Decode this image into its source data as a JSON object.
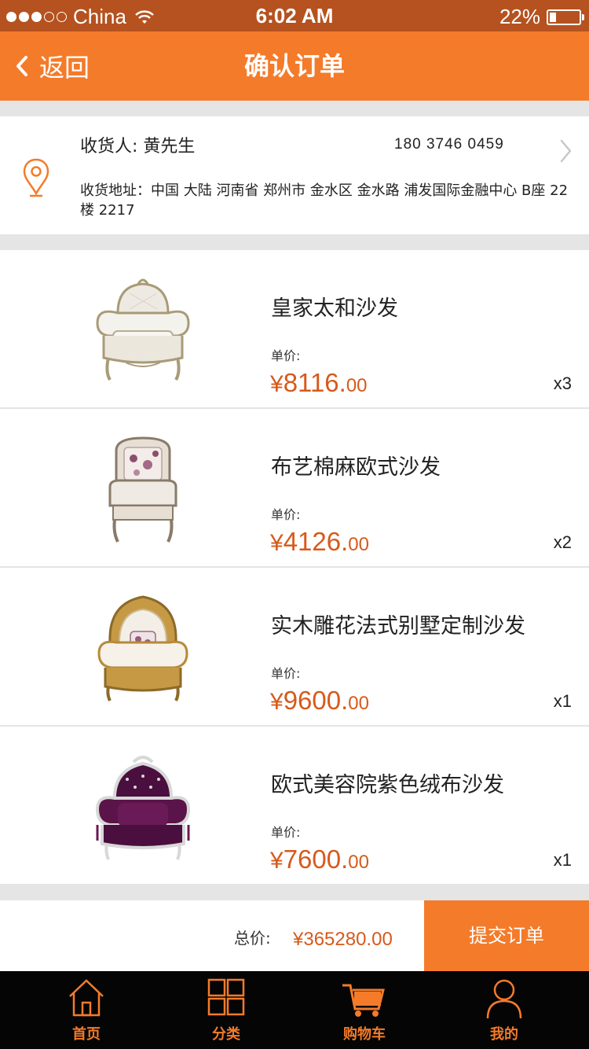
{
  "status_bar": {
    "carrier": "China",
    "time": "6:02 AM",
    "battery_text": "22%",
    "battery_level": 0.22
  },
  "nav": {
    "back_label": "返回",
    "title": "确认订单"
  },
  "address": {
    "consignee": "收货人: 黄先生",
    "phone": "180 3746 0459",
    "address_text": "收货地址：中国 大陆 河南省 郑州市 金水区 金水路 浦发国际金融中心 B座 22楼 2217"
  },
  "items": [
    {
      "name": "皇家太和沙发",
      "price_label": "单价:",
      "currency": "¥",
      "price_int": "8116.",
      "price_dec": "00",
      "qty": "x3",
      "image_icon": "ornate-white-armchair"
    },
    {
      "name": "布艺棉麻欧式沙发",
      "price_label": "单价:",
      "currency": "¥",
      "price_int": "4126.",
      "price_dec": "00",
      "qty": "x2",
      "image_icon": "floral-fabric-chair"
    },
    {
      "name": "实木雕花法式别墅定制沙发",
      "price_label": "单价:",
      "currency": "¥",
      "price_int": "9600.",
      "price_dec": "00",
      "qty": "x1",
      "image_icon": "gold-carved-armchair"
    },
    {
      "name": "欧式美容院紫色绒布沙发",
      "price_label": "单价:",
      "currency": "¥",
      "price_int": "7600.",
      "price_dec": "00",
      "qty": "x1",
      "image_icon": "purple-velvet-armchair"
    }
  ],
  "summary": {
    "total_label": "总价:",
    "total_value": "¥365280.00",
    "submit_label": "提交订单"
  },
  "tabbar": {
    "tabs": [
      {
        "label": "首页",
        "icon": "home-icon"
      },
      {
        "label": "分类",
        "icon": "grid-icon"
      },
      {
        "label": "购物车",
        "icon": "cart-icon",
        "active": true
      },
      {
        "label": "我的",
        "icon": "user-icon"
      }
    ]
  },
  "colors": {
    "accent": "#f47b2a",
    "status_bar": "#b5521f",
    "price": "#d65a1b",
    "tabbar_bg": "#050505"
  }
}
